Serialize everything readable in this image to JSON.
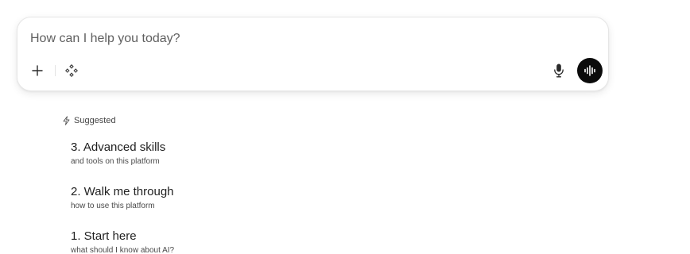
{
  "composer": {
    "placeholder": "How can I help you today?"
  },
  "toolbar": {
    "add_icon": "plus-icon",
    "tools_icon": "diamond-dots-icon",
    "mic_icon": "microphone-icon",
    "voice_icon": "waveform-icon"
  },
  "suggested": {
    "header_icon": "lightning-bolt-icon",
    "header": "Suggested",
    "items": [
      {
        "title": "3. Advanced skills",
        "subtitle": "and tools on this platform"
      },
      {
        "title": "2. Walk me through",
        "subtitle": "how to use this platform"
      },
      {
        "title": "1. Start here",
        "subtitle": "what should I know about AI?"
      }
    ]
  },
  "colors": {
    "voice_button_bg": "#0b0b0b",
    "text_primary": "#1f1f1f",
    "text_secondary": "#4a4a4a"
  }
}
